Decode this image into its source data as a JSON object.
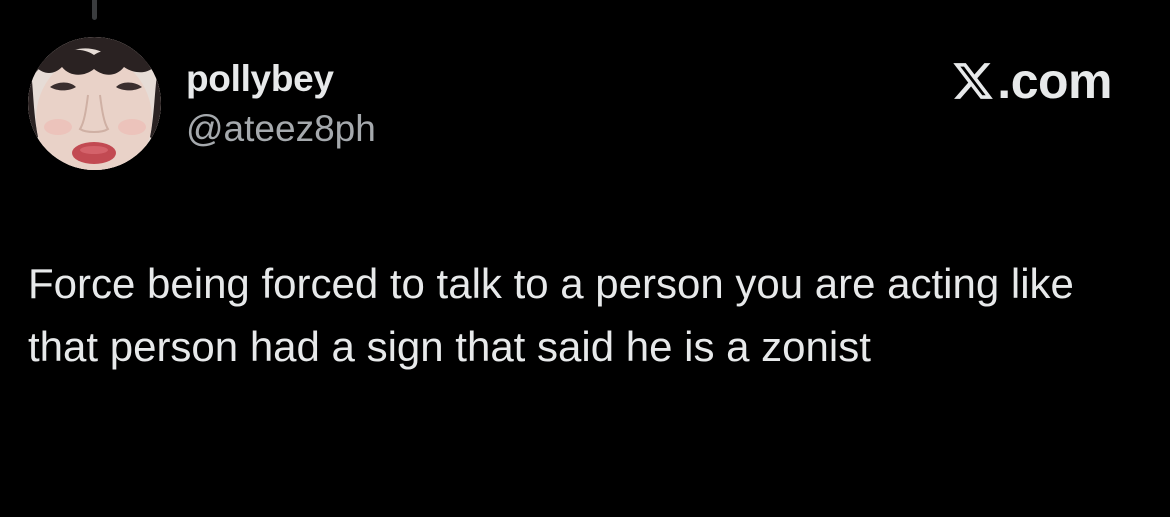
{
  "author": {
    "display_name": "pollybey",
    "handle": "@ateez8ph",
    "avatar_icon": "profile-photo-avatar"
  },
  "brand": {
    "logo_icon": "x-logo-icon",
    "domain": ".com"
  },
  "tweet": {
    "text": "Force being forced to talk to a person you are acting like that person had a sign that said he is a zonist"
  },
  "theme": {
    "background": "#000000",
    "primary_text": "#e7e9ea",
    "secondary_text": "#a5a9ad"
  }
}
